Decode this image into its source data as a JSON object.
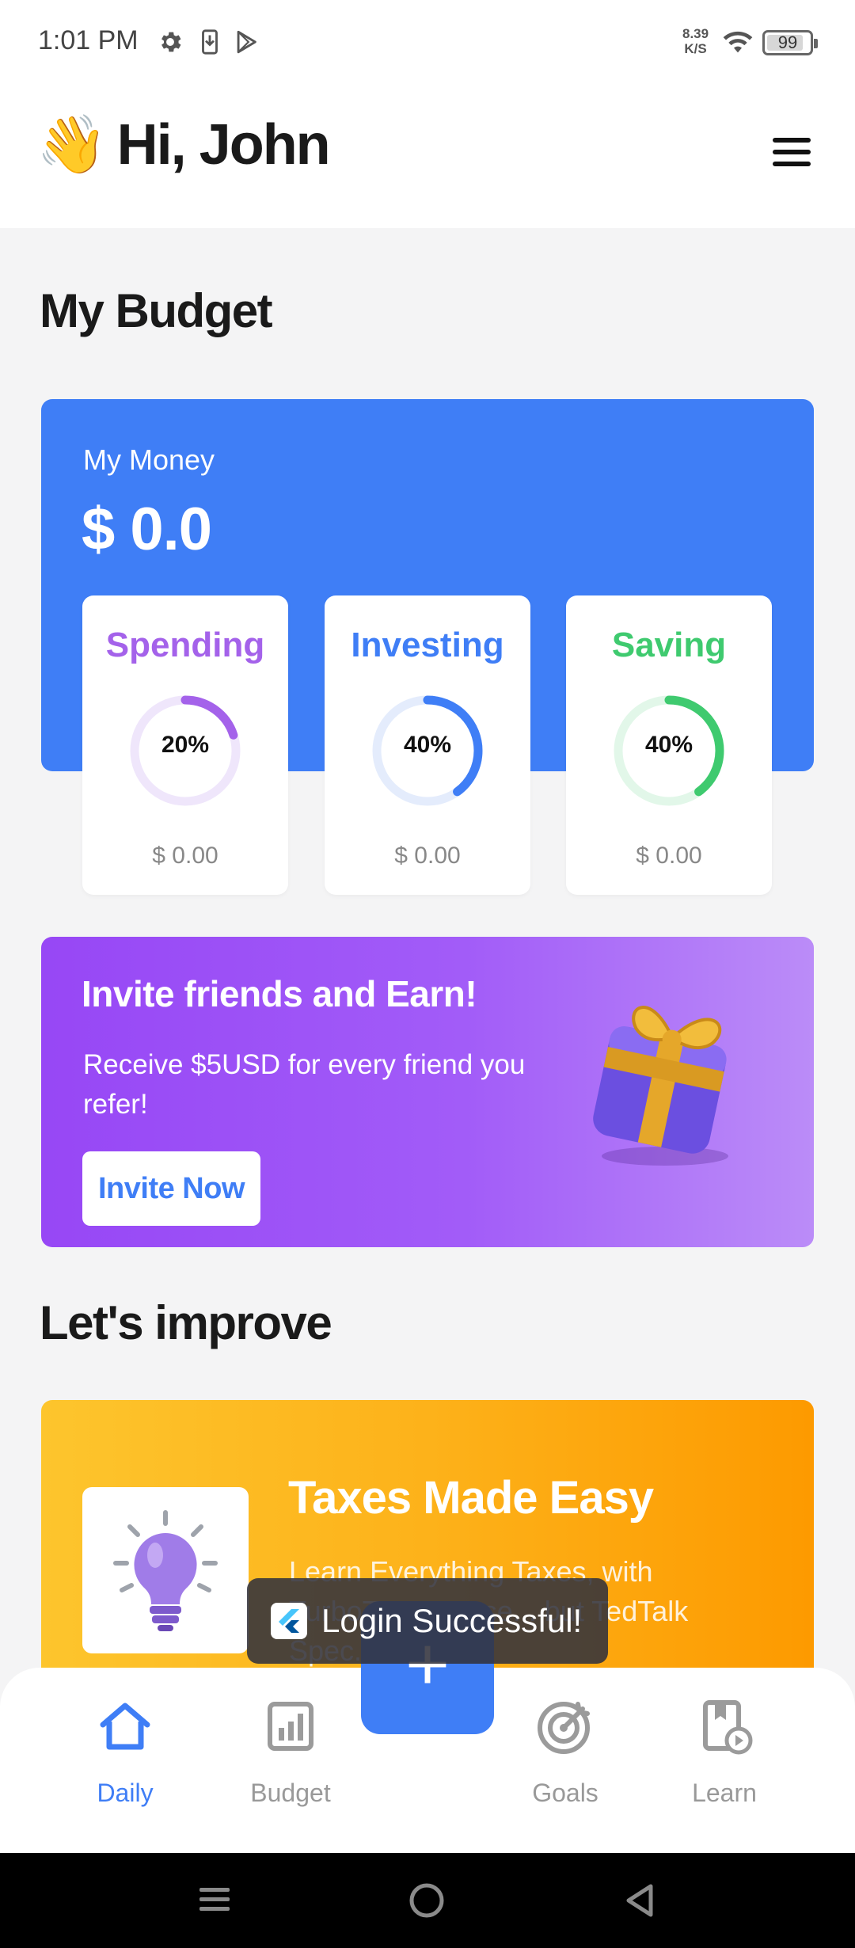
{
  "status_bar": {
    "time": "1:01 PM",
    "net_speed_value": "8.39",
    "net_speed_unit": "K/S",
    "battery": "99",
    "icons": [
      "gear-icon",
      "download-icon",
      "play-store-icon",
      "wifi-icon",
      "battery-icon"
    ]
  },
  "header": {
    "wave_emoji": "👋",
    "greeting": "Hi, John",
    "menu_icon": "hamburger-menu-icon"
  },
  "budget": {
    "section_title": "My Budget",
    "money_label": "My Money",
    "money_value": "$ 0.0",
    "categories": [
      {
        "label": "Spending",
        "percent_text": "20%",
        "percent": 20,
        "amount": "$ 0.00",
        "color": "#a462ea",
        "track": "#efe6fb"
      },
      {
        "label": "Investing",
        "percent_text": "40%",
        "percent": 40,
        "amount": "$ 0.00",
        "color": "#3f7ef6",
        "track": "#e4ecfc"
      },
      {
        "label": "Saving",
        "percent_text": "40%",
        "percent": 40,
        "amount": "$ 0.00",
        "color": "#3fca6f",
        "track": "#e2f7e9"
      }
    ]
  },
  "invite": {
    "title": "Invite friends and Earn!",
    "text": "Receive $5USD for every friend you refer!",
    "button": "Invite Now",
    "image_icon": "gift-box-icon"
  },
  "improve": {
    "section_title": "Let's improve",
    "card_title": "Taxes Made Easy",
    "card_text": "Learn Everything Taxes, with TurboTax ... Dose... but TedTalk Spec...",
    "image_icon": "lightbulb-icon"
  },
  "toast": {
    "message": "Login Successful!",
    "icon": "flutter-logo-icon"
  },
  "bottom_nav": {
    "fab_label": "+",
    "items": [
      {
        "label": "Daily",
        "icon": "home-icon",
        "active": true
      },
      {
        "label": "Budget",
        "icon": "bar-chart-icon",
        "active": false
      },
      {
        "label": "Goals",
        "icon": "target-icon",
        "active": false
      },
      {
        "label": "Learn",
        "icon": "video-book-icon",
        "active": false
      }
    ]
  },
  "colors": {
    "accent_blue": "#3f7ef6",
    "invite_purple": "#9747f5",
    "improve_orange": "#fdb21a"
  }
}
